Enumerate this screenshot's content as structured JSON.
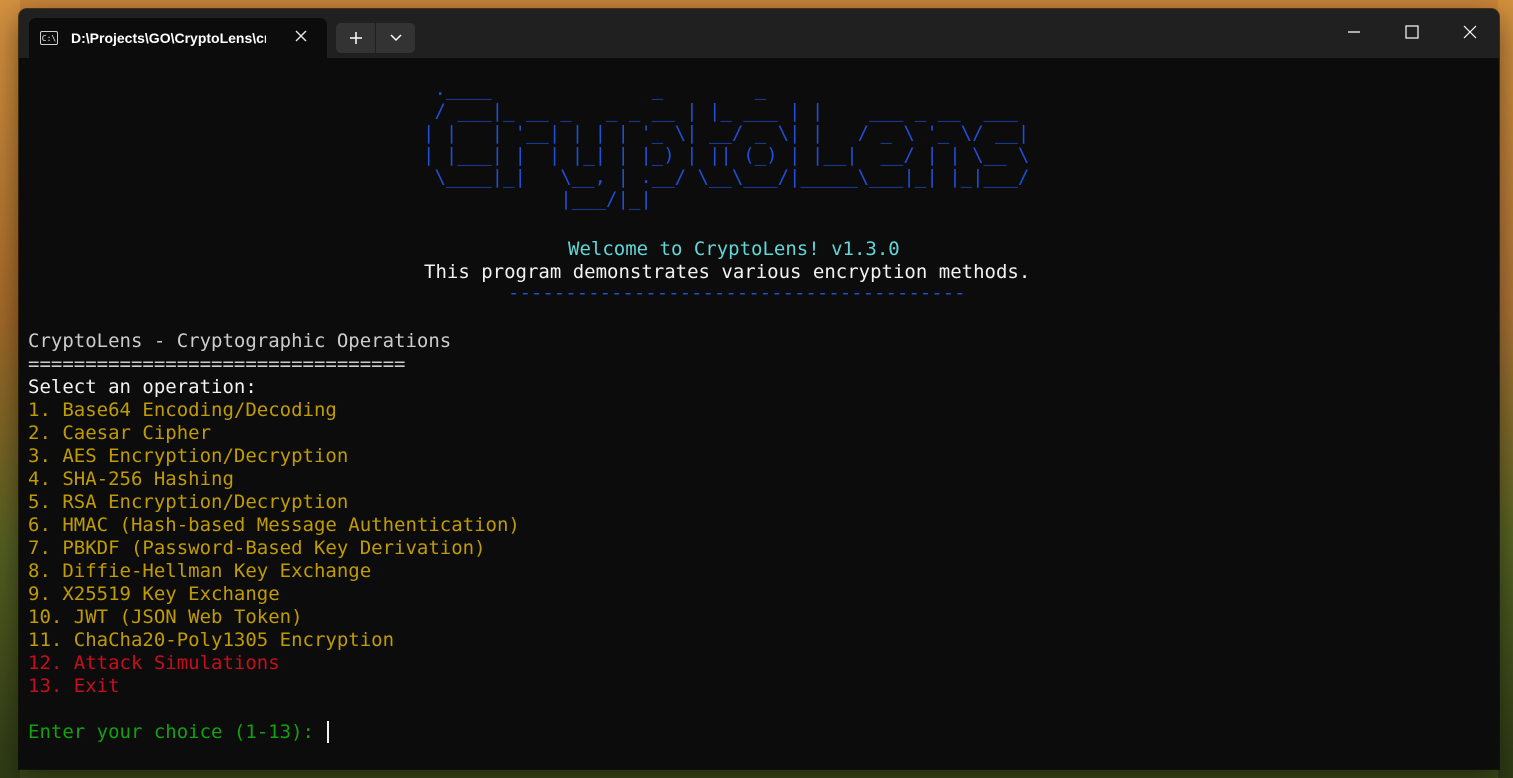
{
  "window": {
    "tab_title": "D:\\Projects\\GO\\CryptoLens\\cr",
    "tab_icon_text": "C:\\"
  },
  "terminal": {
    "banner": [
      " .____              _        _",
      " / ___|_ __ _   _ _ __ | |_ ___ | |    ___ _ __  ___",
      "| |   | '__| | | | '_ \\| __/ _ \\| |   / _ \\ '_ \\/ __|",
      "| |___| |  | |_| | |_) | || (_) | |__|  __/ | | \\__ \\",
      " \\____|_|   \\__, | .__/ \\__\\___/|_____\\___|_| |_|___/",
      "            |___/|_|"
    ],
    "welcome": "Welcome to CryptoLens! v1.3.0",
    "subtitle": "This program demonstrates various encryption methods.",
    "divider": "----------------------------------------",
    "heading": "CryptoLens - Cryptographic Operations",
    "heading_rule": "=================================",
    "prompt_select": "Select an operation:",
    "menu_items": [
      "1. Base64 Encoding/Decoding",
      "2. Caesar Cipher",
      "3. AES Encryption/Decryption",
      "4. SHA-256 Hashing",
      "5. RSA Encryption/Decryption",
      "6. HMAC (Hash-based Message Authentication)",
      "7. PBKDF (Password-Based Key Derivation)",
      "8. Diffie-Hellman Key Exchange",
      "9. X25519 Key Exchange",
      "10. JWT (JSON Web Token)",
      "11. ChaCha20-Poly1305 Encryption"
    ],
    "menu_items_danger": [
      "12. Attack Simulations",
      "13. Exit"
    ],
    "input_prompt": "Enter your choice (1-13): "
  },
  "colors": {
    "banner": "#1e4fd6",
    "welcome": "#61d6d6",
    "menu": "#c19c00",
    "danger": "#c50f1f",
    "prompt": "#13a10e"
  }
}
